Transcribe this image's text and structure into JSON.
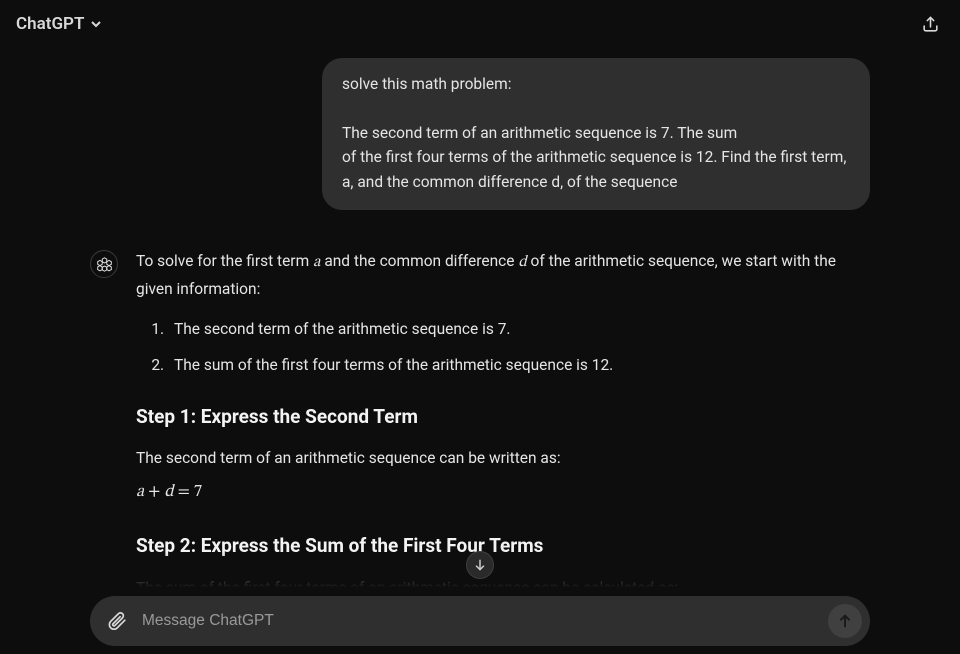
{
  "header": {
    "model_name": "ChatGPT"
  },
  "user_message": "solve this math problem:\n\nThe second term of an arithmetic sequence is 7. The sum\nof the first four terms of the arithmetic sequence is 12. Find the first term,\na, and the common difference d, of the sequence",
  "assistant": {
    "intro_1": "To solve for the first term ",
    "intro_var_a": "a",
    "intro_2": " and the common difference ",
    "intro_var_d": "d",
    "intro_3": " of the arithmetic sequence, we start with the given information:",
    "list": [
      "The second term of the arithmetic sequence is 7.",
      "The sum of the first four terms of the arithmetic sequence is 12."
    ],
    "step1_title": "Step 1: Express the Second Term",
    "step1_text": "The second term of an arithmetic sequence can be written as:",
    "step1_eq_a": "a",
    "step1_eq_plus": " + ",
    "step1_eq_d": "d",
    "step1_eq_eq": " = 7",
    "step2_title": "Step 2: Express the Sum of the First Four Terms",
    "step2_text": "The sum of the first four terms of an arithmetic sequence can be calculated as:"
  },
  "composer": {
    "placeholder": "Message ChatGPT"
  }
}
